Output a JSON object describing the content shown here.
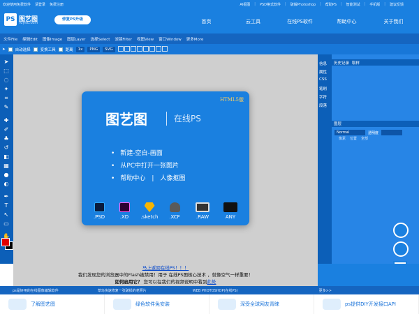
{
  "header": {
    "top_links": [
      "欢迎使用免费软件",
      "请登录",
      "免费注册"
    ],
    "right_links": [
      "AI抠图",
      "PSD格式软件",
      "破解Photoshop",
      "帮助PS",
      "智能测试",
      "手机版",
      "建议反馈"
    ],
    "logo_text": "图艺图",
    "logo_domain": "Tuyitu.com",
    "upgrade_label": "修复PS升级",
    "nav": [
      "首页",
      "云工具",
      "在线PS软件",
      "帮助中心",
      "关于我们"
    ]
  },
  "menubar": [
    "文件File",
    "编辑Edit",
    "图像Image",
    "图层Layer",
    "选择Select",
    "滤镜Filter",
    "视图View",
    "窗口Window",
    "更多More"
  ],
  "options_bar": {
    "auto_select": "自动选择",
    "transform_tool": "变换工具",
    "distance": "距离",
    "zoom": "1x",
    "png_btn": "PNG",
    "svg_btn": "SVG"
  },
  "splash": {
    "badge": "HTML5版",
    "brand": "图艺图",
    "subtitle": "在线PS",
    "actions": [
      "新建-空白-画面",
      "从PC中打开一张图片",
      "帮助中心　|　人像抠图"
    ],
    "formats": [
      {
        "label": ".PSD",
        "color": "#0a1b3d"
      },
      {
        "label": ".XD",
        "color": "#2e0033"
      },
      {
        "label": ".sketch",
        "color": "#f7b500"
      },
      {
        "label": ".XCF",
        "color": "#5a5a5a"
      },
      {
        "label": ".RAW",
        "color": "#333333"
      },
      {
        "label": "ANY",
        "color": "#111111"
      }
    ]
  },
  "right_strip": [
    "信息",
    "属性",
    "CSS",
    "笔刷",
    "字符",
    "段落"
  ],
  "history_panel": {
    "tabs": [
      "历史记录",
      "取样"
    ]
  },
  "layers_panel": {
    "title": "图层",
    "blend_mode": "Normal",
    "opacity_label": "透明度",
    "locks": [
      "像素",
      "位置",
      "全部"
    ]
  },
  "notice": {
    "line1": "马上返回在线PS！！！",
    "line2": "我们发现您的浏览器中的Flash被禁用！用于 在线PS图核心技术 ，就像空气一样重要！",
    "line3_prefix": "如何启用它？",
    "line3_rest": " 您可以在我们的视频说明中看到",
    "line3_link": "此处"
  },
  "status_bar": [
    "ps是好用的在线图像编辑软件",
    "草鸟快速修复一张破损的老照片",
    "WEB PHOTOSHOP(在线PS)",
    "更多>>"
  ],
  "footer": [
    "了解图艺图",
    "绿色软件免安装",
    "深受全球网友青睐",
    "ps提供DIY开发接口API"
  ]
}
